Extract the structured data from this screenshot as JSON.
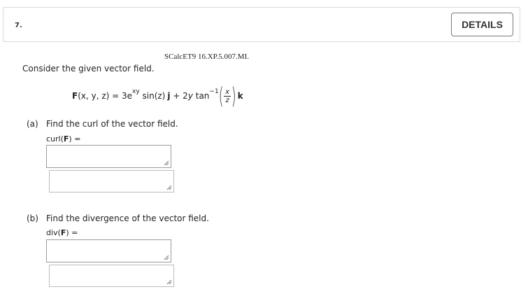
{
  "question": {
    "number": "7.",
    "details_label": "DETAILS",
    "source": "SCalcET9 16.XP.5.007.MI.",
    "prompt": "Consider the given vector field.",
    "formula": {
      "lhs": "F",
      "args": "(x, y, z) = 3e",
      "exp": "xy",
      "mid": " sin(z)",
      "j": "j",
      "plus": " + 2",
      "y": "y",
      "tan": " tan",
      "tan_sup": "−1",
      "frac_num": "x",
      "frac_den": "z",
      "k": "k"
    }
  },
  "part_a": {
    "letter": "(a)",
    "text": "Find the curl of the vector field.",
    "expr_prefix": "curl(",
    "expr_bold": "F",
    "expr_suffix": ") ="
  },
  "part_b": {
    "letter": "(b)",
    "text": "Find the divergence of the vector field.",
    "expr_prefix": "div(",
    "expr_bold": "F",
    "expr_suffix": ") ="
  }
}
